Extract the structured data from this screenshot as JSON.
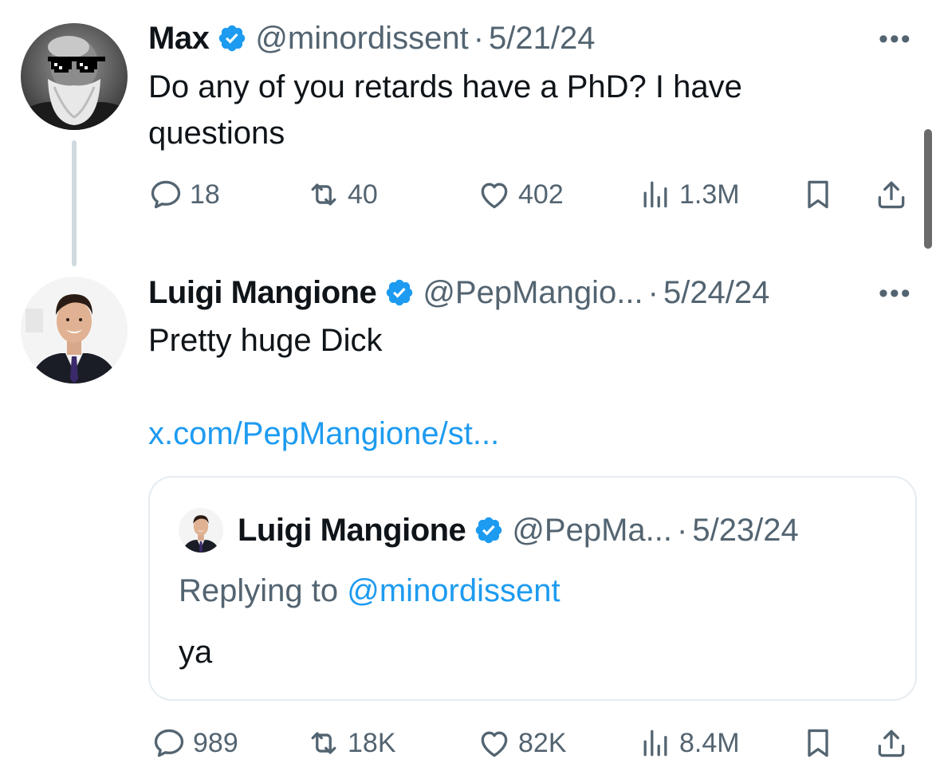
{
  "tweet1": {
    "name": "Max",
    "handle": "@minordissent",
    "separator": "·",
    "date": "5/21/24",
    "text": "Do any of you retards have a PhD? I have questions",
    "stats": {
      "replies": "18",
      "reposts": "40",
      "likes": "402",
      "views": "1.3M"
    }
  },
  "tweet2": {
    "name": "Luigi Mangione",
    "handle": "@PepMangio...",
    "separator": "·",
    "date": "5/24/24",
    "text": "Pretty huge Dick",
    "link": "x.com/PepMangione/st...",
    "quote": {
      "name": "Luigi Mangione",
      "handle": "@PepMa...",
      "separator": "·",
      "date": "5/23/24",
      "replying_prefix": "Replying to",
      "replying_handle": "@minordissent",
      "text": "ya"
    },
    "stats": {
      "replies": "989",
      "reposts": "18K",
      "likes": "82K",
      "views": "8.4M"
    }
  },
  "more_glyph": "•••",
  "colors": {
    "accent": "#1d9bf0",
    "muted": "#536471",
    "text": "#0f1419",
    "border": "#e6ecf0"
  },
  "icons": [
    "reply-icon",
    "repost-icon",
    "like-icon",
    "views-icon",
    "bookmark-icon",
    "share-icon",
    "verified-badge-icon",
    "more-icon"
  ]
}
